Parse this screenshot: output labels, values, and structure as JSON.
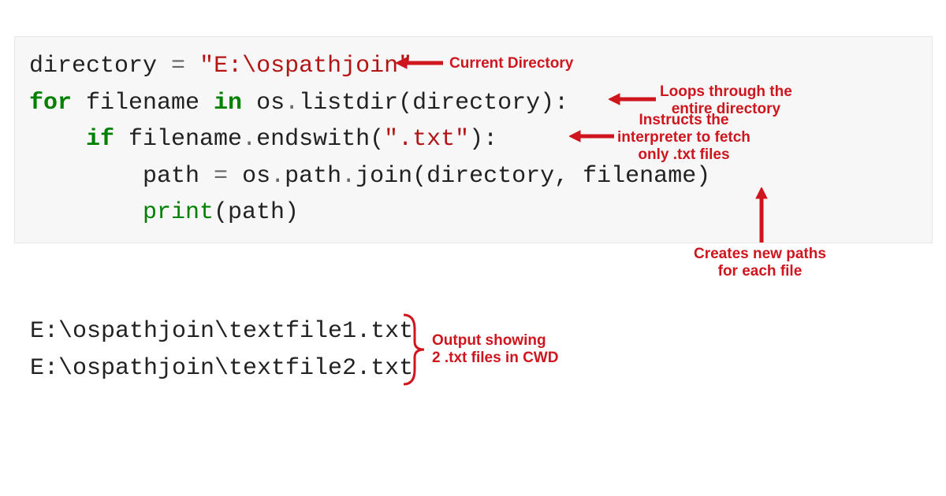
{
  "code": {
    "line1": {
      "a": "directory ",
      "op": "=",
      "b": " ",
      "str": "\"E:\\ospathjoin\"",
      "line1_full": "directory = \"E:\\ospathjoin\""
    },
    "line2": {
      "kw1": "for",
      "a": " filename ",
      "kw2": "in",
      "b": " os",
      "dot1": ".",
      "c": "listdir(directory):"
    },
    "line3": {
      "indent": "    ",
      "kw": "if",
      "a": " filename",
      "dot": ".",
      "b": "endswith(",
      "str": "\".txt\"",
      "c": "):"
    },
    "line4": {
      "indent": "        ",
      "a": "path ",
      "op": "=",
      "b": " os",
      "dot1": ".",
      "c": "path",
      "dot2": ".",
      "d": "join(directory, filename)"
    },
    "line5": {
      "indent": "        ",
      "fn": "print",
      "a": "(path)"
    }
  },
  "output": {
    "line1": "E:\\ospathjoin\\textfile1.txt",
    "line2": "E:\\ospathjoin\\textfile2.txt"
  },
  "annotations": {
    "a1": "Current Directory",
    "a2_l1": "Loops through the",
    "a2_l2": "entire directory",
    "a3_l1": "Instructs the",
    "a3_l2": "interpreter to fetch",
    "a3_l3": "only .txt files",
    "a4_l1": "Creates new paths",
    "a4_l2": "for each file",
    "a5_l1": "Output showing",
    "a5_l2": "2 .txt files in CWD"
  },
  "colors": {
    "annotation": "#cf151e",
    "code_bg": "#f7f7f7"
  }
}
